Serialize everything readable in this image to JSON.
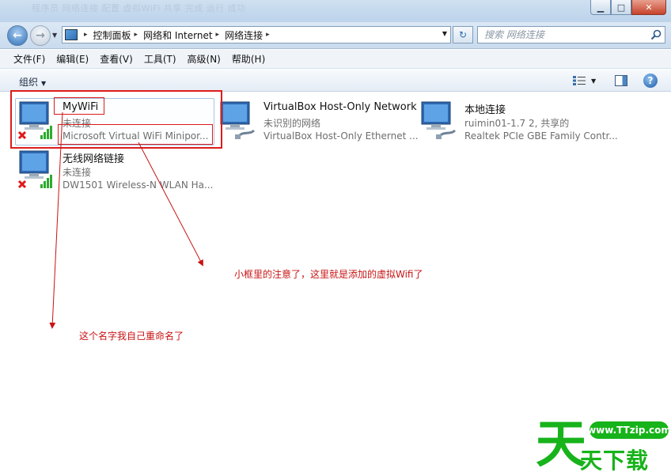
{
  "window": {
    "ghost_title": "程序员 网络连接 配置 虚拟WiFi 共享 完成 运行 成功",
    "minimize": "▁",
    "maximize": "□",
    "close": "✕"
  },
  "address": {
    "crumbs": [
      "控制面板",
      "网络和 Internet",
      "网络连接"
    ],
    "search_placeholder": "搜索 网络连接"
  },
  "menu": [
    "文件(F)",
    "编辑(E)",
    "查看(V)",
    "工具(T)",
    "高级(N)",
    "帮助(H)"
  ],
  "command": {
    "organize": "组织"
  },
  "adapters": [
    {
      "name": "MyWiFi",
      "status": "未连接",
      "device": "Microsoft Virtual WiFi Minipor...",
      "disconnected": true
    },
    {
      "name": "VirtualBox Host-Only Network",
      "status": "未识别的网络",
      "device": "VirtualBox Host-Only Ethernet ...",
      "disconnected": false
    },
    {
      "name": "本地连接",
      "status": "ruimin01-1.7  2, 共享的",
      "device": "Realtek PCIe GBE Family Contr...",
      "disconnected": false
    },
    {
      "name": "无线网络链接",
      "status": "未连接",
      "device": "DW1501 Wireless-N  WLAN Ha...",
      "disconnected": true
    }
  ],
  "annotations": {
    "virtual_wifi_note": "小框里的注意了，这里就是添加的虚拟Wifi了",
    "rename_note": "这个名字我自己重命名了"
  },
  "watermark": {
    "url": "www.TTzip.com",
    "logo_char": "天",
    "text": "天下载"
  },
  "colors": {
    "annotation_red": "#dd1c1c",
    "watermark_green": "#17b31a"
  }
}
